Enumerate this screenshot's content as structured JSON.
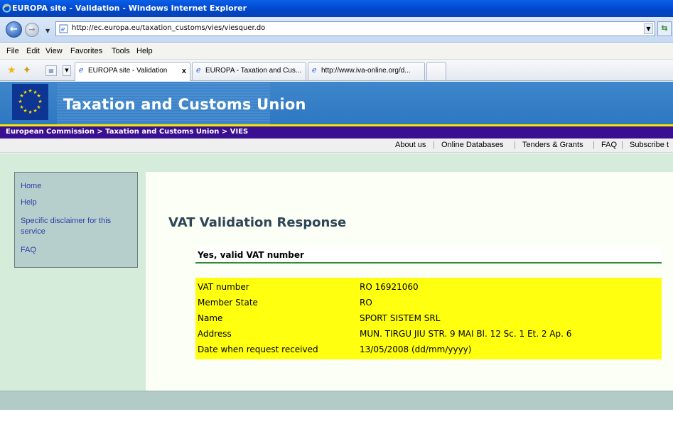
{
  "window": {
    "title": "EUROPA site - Validation - Windows Internet Explorer"
  },
  "address_bar": {
    "url": "http://ec.europa.eu/taxation_customs/vies/viesquer.do"
  },
  "menu": [
    "File",
    "Edit",
    "View",
    "Favorites",
    "Tools",
    "Help"
  ],
  "tabs": [
    {
      "label": "EUROPA site - Validation",
      "close": "x"
    },
    {
      "label": "EUROPA - Taxation and Cus..."
    },
    {
      "label": "http://www.iva-online.org/d..."
    },
    {
      "label": ""
    }
  ],
  "site": {
    "title": "Taxation and Customs Union",
    "breadcrumb": "European Commission > Taxation and Customs Union > VIES"
  },
  "top_nav": {
    "items": [
      "About us",
      "Online Databases",
      "Tenders & Grants",
      "FAQ",
      "Subscribe t"
    ],
    "separator": "|"
  },
  "sidebar": {
    "links": [
      "Home",
      "Help",
      "Specific disclaimer for this",
      "service",
      "FAQ"
    ]
  },
  "main": {
    "heading": "VAT Validation Response",
    "status": "Yes, valid VAT number",
    "rows": [
      {
        "label": "VAT number",
        "value": "RO 16921060"
      },
      {
        "label": "Member State",
        "value": "RO"
      },
      {
        "label": "Name",
        "value": "SPORT SISTEM SRL"
      },
      {
        "label": "Address",
        "value": "MUN. TIRGU JIU STR. 9 MAI Bl. 12 Sc. 1 Et. 2 Ap. 6"
      },
      {
        "label": "Date when request received",
        "value": "13/05/2008 (dd/mm/yyyy)"
      }
    ]
  },
  "colors": {
    "banner": "#2e78c2",
    "breadcrumb_bar": "#3a1093",
    "sidebar_bg": "#d4ecd9",
    "result_highlight": "#ffff10",
    "status_underline": "#2f8a3a"
  },
  "icons": [
    "ie-logo-icon",
    "back-arrow-icon",
    "forward-arrow-icon",
    "page-icon",
    "refresh-icon",
    "favorites-star-icon",
    "add-favorites-icon",
    "quick-tabs-icon",
    "tab-list-icon",
    "eu-flag-icon"
  ]
}
